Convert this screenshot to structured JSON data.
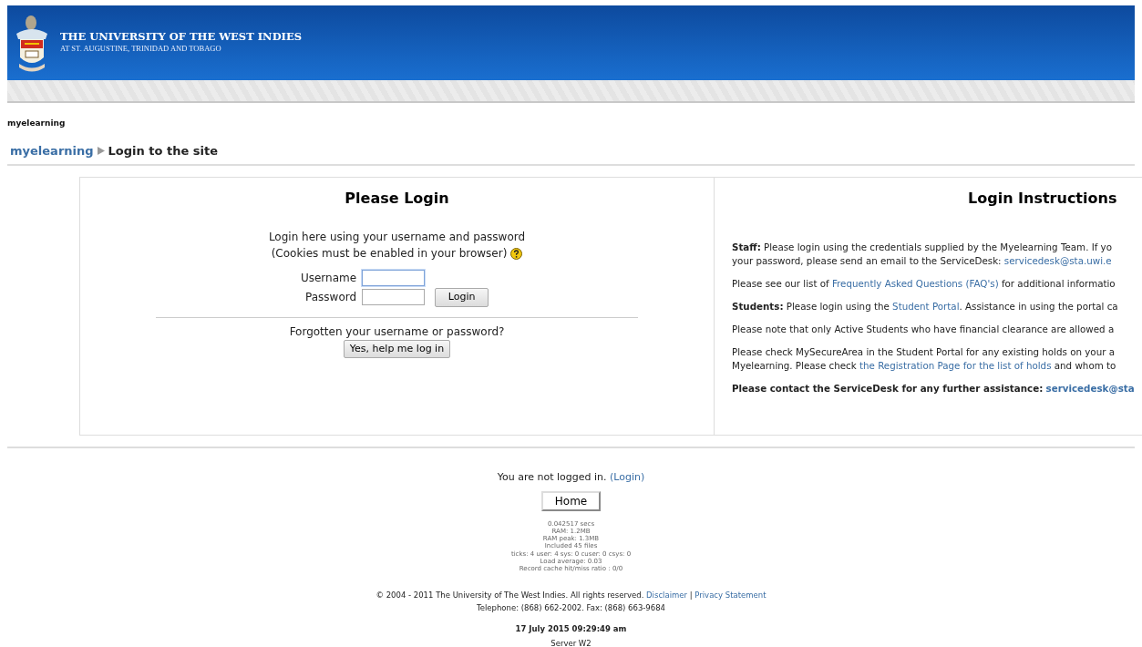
{
  "header": {
    "title": "THE UNIVERSITY OF THE WEST INDIES",
    "subtitle": "AT ST. AUGUSTINE, TRINIDAD AND TOBAGO"
  },
  "site_name": "myelearning",
  "breadcrumb": [
    {
      "label": "myelearning",
      "kind": "link"
    },
    {
      "label": "Login to the site",
      "kind": "current"
    }
  ],
  "login": {
    "title": "Please Login",
    "intro": "Login here using your username and password",
    "cookies_note": "(Cookies must be enabled in your browser)",
    "fields": [
      {
        "label": "Username",
        "focused": true
      },
      {
        "label": "Password",
        "focused": false
      }
    ],
    "login_button": "Login",
    "forgot_text": "Forgotten your username or password?",
    "forgot_button": "Yes, help me log in"
  },
  "instructions": {
    "title": "Login Instructions",
    "paragraphs": [
      [
        [
          {
            "kind": "text",
            "text": "**Staff:** Please login using the credentials supplied by the Myelearning Team. If yo"
          }
        ],
        [
          {
            "kind": "text",
            "text": "your password, please send an email to the ServiceDesk: "
          },
          {
            "kind": "link",
            "text": "servicedesk@sta.uwi.e"
          }
        ]
      ],
      [
        [
          {
            "kind": "text",
            "text": "Please see our list of "
          },
          {
            "kind": "link",
            "text": "Frequently Asked Questions (FAQ's)"
          },
          {
            "kind": "text",
            "text": " for additional informatio"
          }
        ]
      ],
      [
        [
          {
            "kind": "text",
            "text": "**Students:** Please login using the "
          },
          {
            "kind": "link",
            "text": "Student Portal"
          },
          {
            "kind": "text",
            "text": ". Assistance in using the portal ca"
          }
        ]
      ],
      [
        [
          {
            "kind": "text",
            "text": "Please note that only Active Students who have financial clearance are allowed a"
          }
        ]
      ],
      [
        [
          {
            "kind": "text",
            "text": "Please check MySecureArea in the Student Portal for any existing holds on your a"
          }
        ],
        [
          {
            "kind": "text",
            "text": "Myelearning. Please check "
          },
          {
            "kind": "link",
            "text": "the Registration Page for the list of holds"
          },
          {
            "kind": "text",
            "text": " and whom to"
          }
        ]
      ],
      [
        [
          {
            "kind": "text",
            "text": "**Please contact the ServiceDesk for any further assistance:** "
          },
          {
            "kind": "boldlink",
            "text": "servicedesk@sta"
          }
        ]
      ]
    ]
  },
  "footer": {
    "login_status": "You are not logged in.",
    "login_link": "(Login)",
    "home_button": "Home",
    "perf": [
      "0.042517 secs",
      "RAM: 1.2MB",
      "RAM peak: 1.3MB",
      "Included 45 files",
      "ticks: 4 user: 4 sys: 0 cuser: 0 csys: 0",
      "Load average: 0.03",
      "Record cache hit/miss ratio : 0/0"
    ],
    "copyright": "© 2004 - 2011 The University of The West Indies. All rights reserved.",
    "links": [
      "Disclaimer",
      "Privacy Statement"
    ],
    "separator": "|",
    "contact": "Telephone: (868) 662-2002. Fax: (868) 663-9684",
    "date": "17 July 2015 09:29:49 am",
    "server": "Server W2"
  }
}
